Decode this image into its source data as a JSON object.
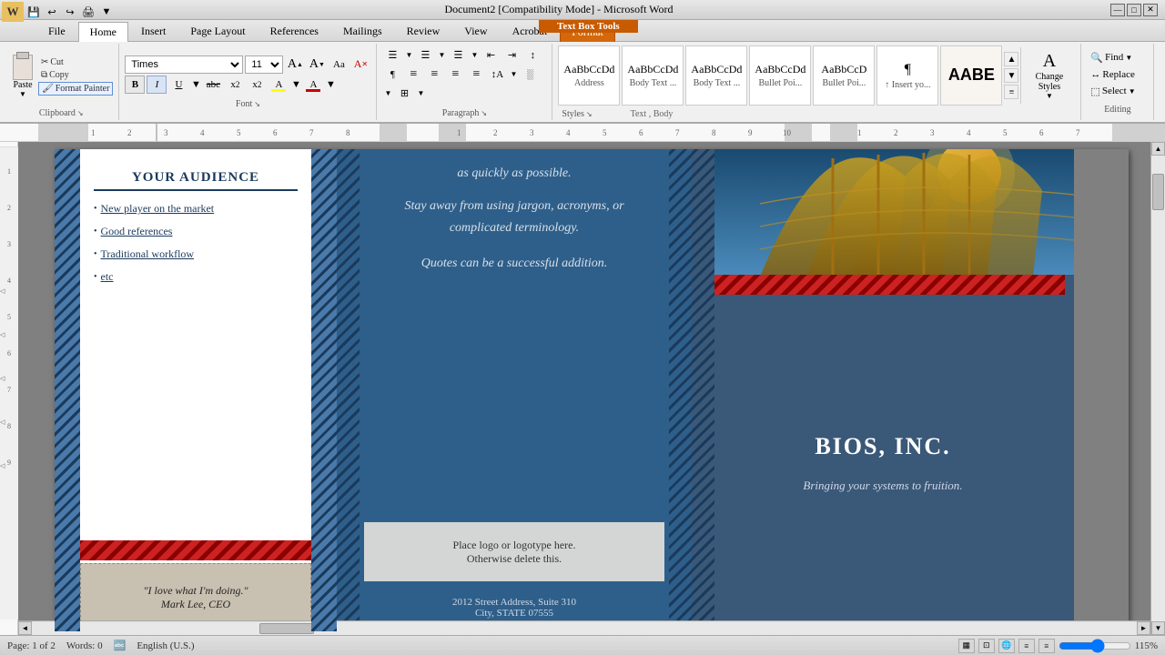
{
  "titlebar": {
    "title": "Document2 [Compatibility Mode] - Microsoft Word",
    "minimize": "—",
    "maximize": "□",
    "close": "✕"
  },
  "textboxtoolstab": {
    "label": "Text Box Tools"
  },
  "ribbontabs": {
    "file": "File",
    "home": "Home",
    "insert": "Insert",
    "pagelayout": "Page Layout",
    "references": "References",
    "mailings": "Mailings",
    "review": "Review",
    "view": "View",
    "acrobat": "Acrobat",
    "format": "Format"
  },
  "clipboard": {
    "paste_label": "Paste",
    "cut_label": "Cut",
    "copy_label": "Copy",
    "format_painter_label": "Format Painter",
    "group_label": "Clipboard"
  },
  "font": {
    "name": "Times",
    "size": "11",
    "bold": "B",
    "italic": "I",
    "underline": "U",
    "strikethrough": "abc",
    "subscript": "x₂",
    "superscript": "x²",
    "grow": "A",
    "shrink": "A",
    "case": "Aa",
    "clear": "A",
    "highlight": "A",
    "color": "A",
    "group_label": "Font"
  },
  "paragraph": {
    "bullets": "☰",
    "numbering": "☰",
    "multilevel": "☰",
    "indent_decrease": "⇤",
    "indent_increase": "⇥",
    "sort": "↕",
    "show_marks": "¶",
    "align_left": "≡",
    "align_center": "≡",
    "align_right": "≡",
    "justify": "≡",
    "line_spacing": "↕",
    "shading": "░",
    "borders": "⊞",
    "group_label": "Paragraph"
  },
  "styles": {
    "items": [
      {
        "name": "Address",
        "preview": "Address",
        "style": "normal"
      },
      {
        "name": "Body Text ...",
        "preview": "AaBbCcDd",
        "style": "body"
      },
      {
        "name": "Body Text ...",
        "preview": "AaBbCcDd",
        "style": "body2"
      },
      {
        "name": "Bullet Poi...",
        "preview": "AaBbCcDd",
        "style": "bullet"
      },
      {
        "name": "Bullet Poi...",
        "preview": "AaBbCcD",
        "style": "bullet2"
      },
      {
        "name": "↑ Insert yo...",
        "preview": "¶",
        "style": "insert"
      },
      {
        "name": "AABE",
        "preview": "AABE",
        "style": "heading"
      }
    ],
    "change_styles_label": "Change\nStyles",
    "group_label": "Styles",
    "text_body_label": "Text , Body"
  },
  "editing": {
    "find_label": "Find",
    "replace_label": "Replace",
    "select_label": "Select",
    "group_label": "Editing"
  },
  "document": {
    "panel_left": {
      "title": "YOUR AUDIENCE",
      "bullets": [
        "New player on the market",
        "Good references",
        "Traditional workflow",
        "etc"
      ],
      "quote": "\"I love what I'm doing.\"\nMark Lee, CEO"
    },
    "panel_middle": {
      "text1": "as quickly as possible.",
      "text2": "Stay away from using jargon, acronyms,\nor complicated terminology.",
      "text3": "Quotes can be a successful addition.",
      "logo_text1": "Place logo  or logotype here.",
      "logo_text2": "Otherwise delete this.",
      "address1": "2012 Street Address,  Suite 310",
      "address2": "City, STATE 07555"
    },
    "panel_right": {
      "company": "BIOS, INC.",
      "tagline": "Bringing your systems to fruition."
    }
  },
  "statusbar": {
    "page": "Page: 1 of 2",
    "words": "Words: 0",
    "language": "English (U.S.)",
    "zoom": "115%"
  }
}
